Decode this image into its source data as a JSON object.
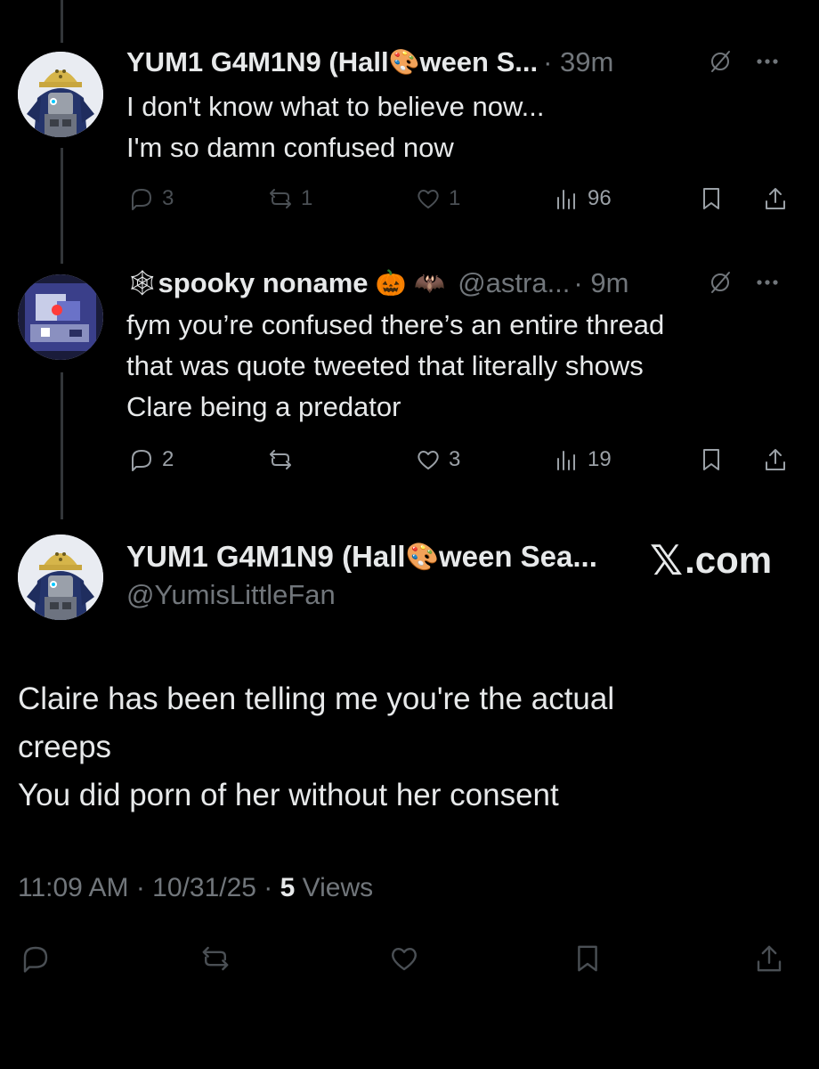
{
  "tweet1": {
    "name_part1": "YUM1 G4M1N9 (Hall",
    "name_emoji": "🎨",
    "name_part2": "ween S...",
    "time": "· 39m",
    "text_line1": "I don't know what to believe now...",
    "text_line2": "I'm so damn confused now",
    "replies": "3",
    "reposts": "1",
    "likes": "1",
    "views": "96"
  },
  "tweet2": {
    "name_emoji_prefix": "🕸",
    "name": "spooky noname",
    "name_emoji_suffix": "🎃 🦇",
    "handle": "@astra...",
    "time": "· 9m",
    "text_line1": "fym you’re confused there’s an entire thread",
    "text_line2": "that was quote tweeted that literally shows",
    "text_line3": "Clare being a predator",
    "replies": "2",
    "likes": "3",
    "views": "19"
  },
  "main_tweet": {
    "name_part1": "YUM1 G4M1N9 (Hall",
    "name_emoji": "🎨",
    "name_part2": "ween Sea...",
    "handle": "@YumisLittleFan",
    "site_mark": "𝕏",
    "site_text": ".com",
    "text_line1": "Claire has been telling me you're the actual",
    "text_line2": "creeps",
    "text_line3": "You did porn of her without her consent",
    "timestamp": "11:09 AM · 10/31/25 · ",
    "views_count": "5",
    "views_label": " Views"
  },
  "icons": {
    "reply": "reply-icon",
    "repost": "repost-icon",
    "like": "heart-icon",
    "views": "views-icon",
    "bookmark": "bookmark-icon",
    "share": "share-icon",
    "grok": "grok-icon",
    "more": "more-icon"
  },
  "colors": {
    "background": "#000000",
    "text": "#e7e9ea",
    "muted": "#71767b"
  }
}
